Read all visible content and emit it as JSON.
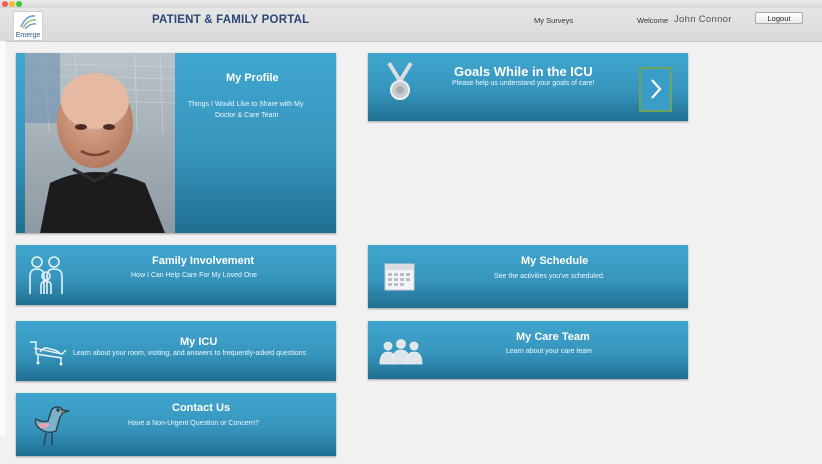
{
  "header": {
    "logo_text": "Emerge",
    "portal_title": "PATIENT & FAMILY PORTAL",
    "surveys_link": "My Surveys",
    "welcome_label": "Welcome",
    "user_name": "John Connor",
    "logout_label": "Logout"
  },
  "tiles": {
    "profile": {
      "title": "My Profile",
      "subtitle_line1": "Things I Would Like to Share with My",
      "subtitle_line2": "Doctor & Care Team"
    },
    "goals": {
      "title": "Goals While in the ICU",
      "subtitle": "Please help us understand your goals of care!"
    },
    "family": {
      "title": "Family Involvement",
      "subtitle": "How I Can Help Care For My Loved One"
    },
    "schedule": {
      "title": "My Schedule",
      "subtitle": "See the activities you've scheduled."
    },
    "icu": {
      "title": "My ICU",
      "subtitle": "Learn about your room, visiting, and answers to frequently-asked questions"
    },
    "care_team": {
      "title": "My Care Team",
      "subtitle": "Learn about your care team"
    },
    "contact": {
      "title": "Contact Us",
      "subtitle": "Have a Non-Urgent Question or Concern?"
    }
  },
  "colors": {
    "tile_top": "#40a6cf",
    "tile_bottom": "#1f6f92",
    "title_text": "#2a4776",
    "arrow_border": "#6ea35a"
  },
  "icons": {
    "goals": "medal-icon",
    "family": "family-icon",
    "schedule": "calendar-icon",
    "icu": "hospital-bed-icon",
    "care_team": "care-team-icon",
    "contact": "bird-icon",
    "goals_arrow": "chevron-right-icon"
  }
}
